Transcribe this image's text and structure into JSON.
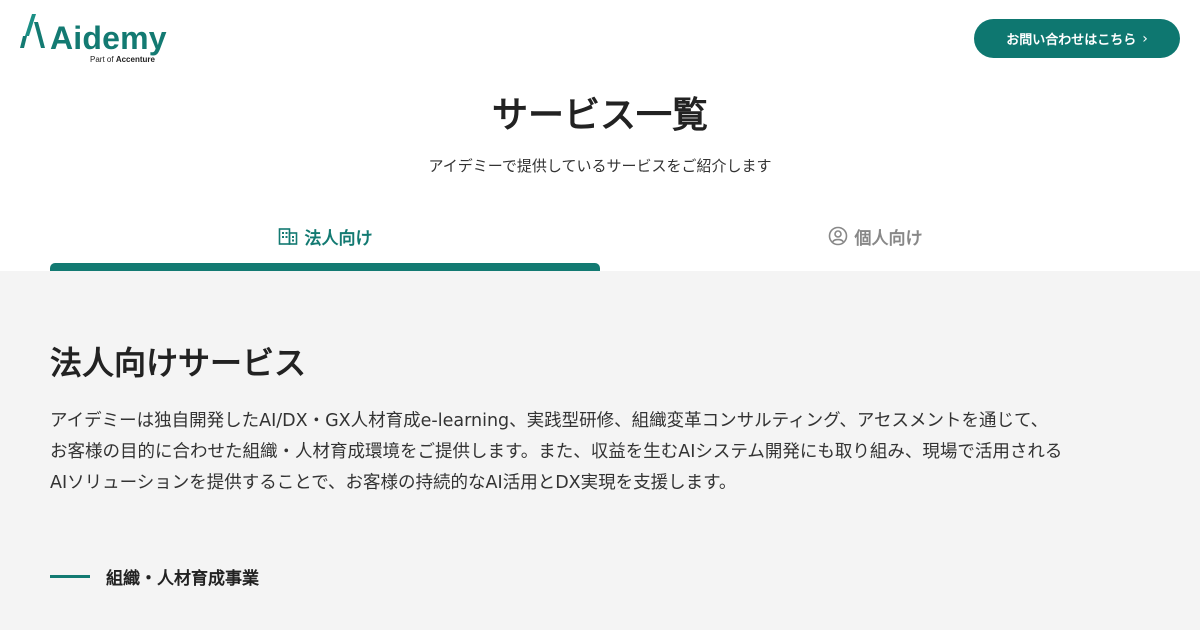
{
  "brand": {
    "name": "Aidemy",
    "sub_prefix": "Part of",
    "sub_company": "Accenture",
    "accent_color": "#137a72"
  },
  "header": {
    "contact_label": "お問い合わせはこちら",
    "contact_icon": "chevron-right-icon"
  },
  "page": {
    "title": "サービス一覧",
    "subtitle": "アイデミーで提供しているサービスをご紹介します"
  },
  "tabs": [
    {
      "label": "法人向け",
      "icon": "building-icon",
      "active": true
    },
    {
      "label": "個人向け",
      "icon": "person-circle-icon",
      "active": false
    }
  ],
  "section": {
    "heading": "法人向けサービス",
    "description_lines": [
      "アイデミーは独自開発したAI/DX・GX人材育成e-learning、実践型研修、組織変革コンサルティング、アセスメントを通じて、",
      "お客様の目的に合わせた組織・人材育成環境をご提供します。また、収益を生むAIシステム開発にも取り組み、現場で活用される",
      "AIソリューションを提供することで、お客様の持続的なAI活用とDX実現を支援します。"
    ],
    "sub_title": "組織・人材育成事業"
  }
}
